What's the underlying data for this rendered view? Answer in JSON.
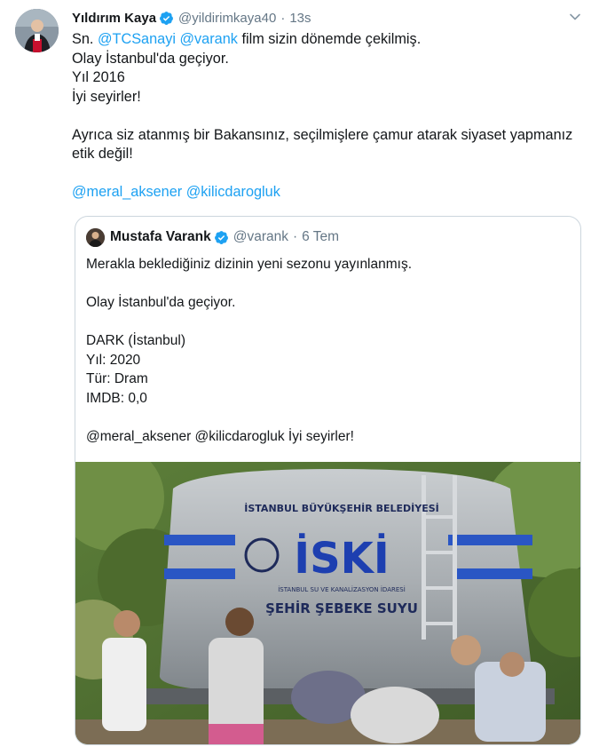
{
  "tweet": {
    "author_name": "Yıldırım Kaya",
    "author_handle": "@yildirimkaya40",
    "separator": "·",
    "time": "13s",
    "lines": {
      "l1_prefix": "Sn. ",
      "l1_mention1": "@TCSanayi",
      "l1_mention2": "@varank",
      "l1_suffix": " film sizin dönemde çekilmiş.",
      "l2": "Olay İstanbul'da geçiyor.",
      "l3": "Yıl 2016",
      "l4": "İyi seyirler!",
      "l5": "Ayrıca siz atanmış bir Bakansınız, seçilmişlere çamur atarak siyaset yapmanız etik değil!",
      "l6_mention1": "@meral_aksener",
      "l6_mention2": "@kilicdarogluk"
    }
  },
  "quoted_tweet": {
    "author_name": "Mustafa Varank",
    "author_handle": "@varank",
    "separator": "·",
    "time": "6 Tem",
    "lines": {
      "l1": "Merakla beklediğiniz dizinin yeni sezonu yayınlanmış.",
      "l2": "Olay İstanbul'da geçiyor.",
      "l3": "DARK (İstanbul)",
      "l4": "Yıl: 2020",
      "l5": "Tür: Dram",
      "l6": "IMDB: 0,0",
      "l7": "@meral_aksener @kilicdarogluk İyi seyirler!"
    },
    "image": {
      "tank_text_top": "İSTANBUL BÜYÜKŞEHİR BELEDİYESİ",
      "tank_logo": "İSKİ",
      "tank_text_sub": "İSTANBUL SU VE KANALİZASYON İDARESİ",
      "tank_text_bottom": "ŞEHİR ŞEBEKE SUYU"
    }
  },
  "colors": {
    "accent": "#1da1f2",
    "muted": "#657786",
    "text": "#14171a",
    "border": "#ccd6dd"
  }
}
